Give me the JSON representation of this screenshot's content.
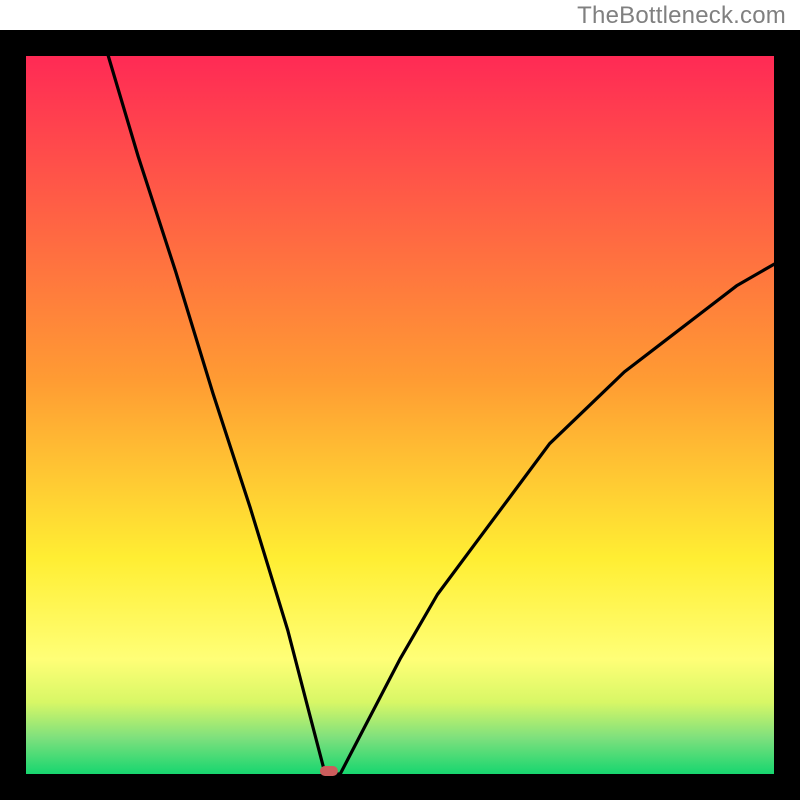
{
  "watermark": "TheBottleneck.com",
  "chart_data": {
    "type": "line",
    "title": "",
    "xlabel": "",
    "ylabel": "",
    "xlim": [
      0,
      100
    ],
    "ylim": [
      0,
      100
    ],
    "notch_x": 40,
    "series": [
      {
        "name": "curve",
        "x": [
          11,
          15,
          20,
          25,
          30,
          35,
          38,
          40,
          42,
          45,
          50,
          55,
          60,
          65,
          70,
          75,
          80,
          85,
          90,
          95,
          100
        ],
        "values": [
          100,
          86,
          70,
          53,
          37,
          20,
          8,
          0,
          0,
          6,
          16,
          25,
          32,
          39,
          46,
          51,
          56,
          60,
          64,
          68,
          71
        ]
      }
    ],
    "background_gradient": {
      "top": "#ff2a55",
      "mid": "#ffee33",
      "green1": "#d8f766",
      "green2": "#7de07d",
      "bottom": "#17d66f"
    },
    "marker": {
      "x": 40.5,
      "color": "#cc5d5d"
    },
    "frame_color": "#000000",
    "frame_thickness_px": 26
  }
}
